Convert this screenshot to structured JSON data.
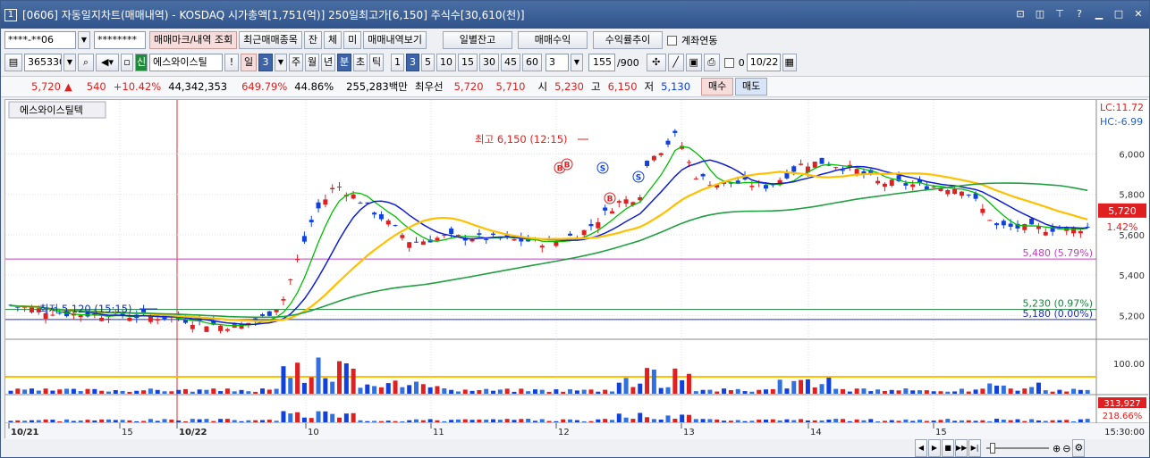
{
  "title": {
    "num": "1",
    "text": "[0606] 자동일지차트(매매내역) - KOSDAQ 시가총액[1,751(억)] 250일최고가[6,150] 주식수[30,610(천)]"
  },
  "toolbar1": {
    "account": "****-**06",
    "password": "********",
    "trade_mark": "매매마크/내역 조회",
    "recent": "최근매매종목",
    "jan": "잔",
    "che": "체",
    "mi": "미",
    "trade_view": "매매내역보기",
    "daily_balance": "일별잔고",
    "trade_profit": "매매수익",
    "return_trend": "수익률추이",
    "account_link": "계좌연동"
  },
  "toolbar2": {
    "code": "365330",
    "sin": "신",
    "name": "에스와이스틸",
    "bang": "!",
    "il": "일",
    "il_num": "3",
    "periods": [
      "주",
      "월",
      "년",
      "분",
      "초",
      "틱"
    ],
    "intervals": [
      "1",
      "3",
      "5",
      "10",
      "15",
      "30",
      "45",
      "60"
    ],
    "interval_sel": "3",
    "count": "155",
    "count_total": "/900",
    "date_box": "0",
    "date": "10/22"
  },
  "quote": {
    "price": "5,720",
    "arrow": "▲",
    "change": "540",
    "change_pct": "+10.42%",
    "volume": "44,342,353",
    "vol_ratio": "649.79%",
    "turnover": "44.86%",
    "amount": "255,283백만",
    "best_label": "최우선",
    "ask": "5,720",
    "bid": "5,710",
    "open_label": "시",
    "open": "5,230",
    "high_label": "고",
    "high": "6,150",
    "low_label": "저",
    "low": "5,130",
    "buy": "매수",
    "sell": "매도"
  },
  "chart": {
    "stock_label": "에스와이스틸텍",
    "lc": "LC:11.72",
    "hc": "HC:-6.99",
    "price_ticks": [
      "6,000",
      "5,800",
      "5,600",
      "5,400",
      "5,200"
    ],
    "current_price": "5,720",
    "current_pct": "1.42%",
    "high_note": "최고 6,150 (12:15)",
    "low_note": "최저 5,120 (15:15)",
    "level_5480": "5,480 (5.79%)",
    "level_5230": "5,230 (0.97%)",
    "level_5180": "5,180 (0.00%)",
    "vol_tick": "100.00",
    "vol2_val": "313,927",
    "vol2_pct": "218.66%",
    "x_labels": [
      "10/21",
      "15",
      "10/22",
      "10",
      "11",
      "12",
      "13",
      "14",
      "15"
    ],
    "time_label": "15:30:00"
  },
  "chart_data": {
    "type": "candlestick",
    "price_range": [
      5100,
      6250
    ],
    "high": 6150,
    "low": 5120,
    "last": 5720,
    "levels": [
      5480,
      5230,
      5180
    ],
    "ma_colors": {
      "fast": "#00c000",
      "mid": "#1020d0",
      "slow": "#ffc000",
      "long": "#20a040"
    },
    "marks": [
      "B",
      "S",
      "S",
      "S",
      "B"
    ]
  }
}
